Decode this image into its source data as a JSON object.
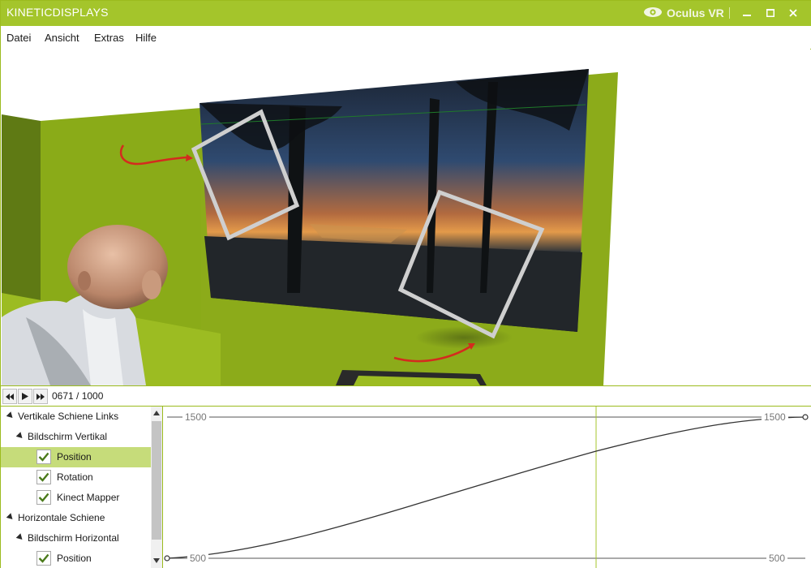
{
  "app": {
    "title": "KINETICDISPLAYS",
    "brand": "Oculus VR",
    "accent": "#a4c52b"
  },
  "menu": [
    "Datei",
    "Ansicht",
    "Extras",
    "Hilfe"
  ],
  "playback": {
    "frame": "0671 / 1000",
    "current_frame": 671,
    "total_frames": 1000
  },
  "tree": [
    {
      "label": "Vertikale Schiene Links",
      "level": 0,
      "type": "group",
      "expanded": true
    },
    {
      "label": "Bildschirm Vertikal",
      "level": 1,
      "type": "group",
      "expanded": true
    },
    {
      "label": "Position",
      "level": 2,
      "type": "check",
      "checked": true,
      "selected": true
    },
    {
      "label": "Rotation",
      "level": 2,
      "type": "check",
      "checked": true
    },
    {
      "label": "Kinect Mapper",
      "level": 2,
      "type": "check",
      "checked": true
    },
    {
      "label": "Horizontale Schiene",
      "level": 0,
      "type": "group",
      "expanded": true
    },
    {
      "label": "Bildschirm Horizontal",
      "level": 1,
      "type": "group",
      "expanded": true
    },
    {
      "label": "Position",
      "level": 2,
      "type": "check",
      "checked": true
    }
  ],
  "curve": {
    "top_value": "1500",
    "bottom_value": "500",
    "top_right_label": "1500",
    "bottom_right_label": "500",
    "playhead_frame": 671
  }
}
